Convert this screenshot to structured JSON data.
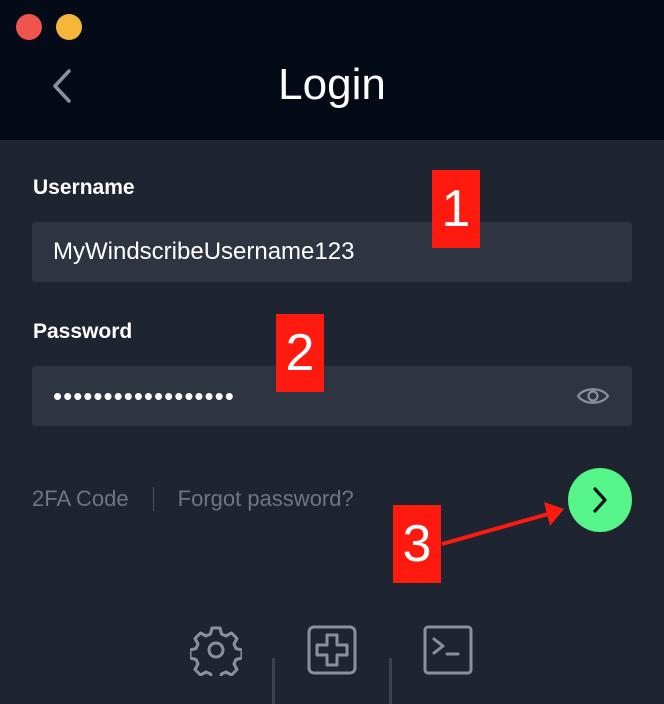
{
  "window": {
    "title": "Login"
  },
  "form": {
    "username_label": "Username",
    "username_value": "MyWindscribeUsername123",
    "password_label": "Password",
    "password_masked": "••••••••••••••••••"
  },
  "links": {
    "twofa": "2FA Code",
    "forgot": "Forgot password?"
  },
  "annotations": {
    "one": "1",
    "two": "2",
    "three": "3"
  },
  "icons": {
    "back": "chevron-left-icon",
    "eye": "eye-icon",
    "go": "chevron-right-icon",
    "settings": "gear-icon",
    "add": "plus-square-icon",
    "terminal": "terminal-icon"
  },
  "colors": {
    "header_bg": "#050b16",
    "body_bg": "#1e2430",
    "field_bg": "#2e3440",
    "accent_green": "#55f58a",
    "annotation_red": "#ff1a10"
  }
}
